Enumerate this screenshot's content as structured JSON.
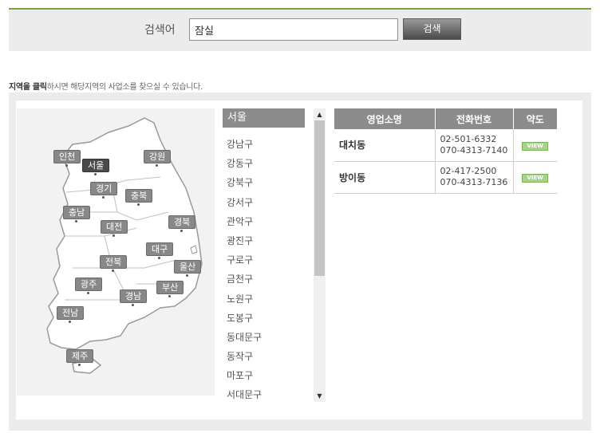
{
  "search": {
    "label": "검색어",
    "value": "잠실",
    "button": "검색"
  },
  "hint": {
    "bold": "지역을 클릭",
    "rest": "하시면 해당지역의 사업소를 찾으실 수 있습니다."
  },
  "map": {
    "regions": [
      {
        "label": "인천"
      },
      {
        "label": "서울",
        "active": true
      },
      {
        "label": "강원"
      },
      {
        "label": "경기"
      },
      {
        "label": "충북"
      },
      {
        "label": "충남"
      },
      {
        "label": "대전"
      },
      {
        "label": "경북"
      },
      {
        "label": "대구"
      },
      {
        "label": "전북"
      },
      {
        "label": "울산"
      },
      {
        "label": "광주"
      },
      {
        "label": "부산"
      },
      {
        "label": "경남"
      },
      {
        "label": "전남"
      },
      {
        "label": "제주"
      }
    ]
  },
  "districts": {
    "header": "서울",
    "items": [
      "강남구",
      "강동구",
      "강북구",
      "강서구",
      "관악구",
      "광진구",
      "구로구",
      "금천구",
      "노원구",
      "도봉구",
      "동대문구",
      "동작구",
      "마포구",
      "서대문구"
    ]
  },
  "table": {
    "headers": [
      "영업소명",
      "전화번호",
      "약도"
    ],
    "rows": [
      {
        "name": "대치동",
        "phone1": "02-501-6332",
        "phone2": "070-4313-7140",
        "map": "VIEW"
      },
      {
        "name": "방이동",
        "phone1": "02-417-2500",
        "phone2": "070-4313-7136",
        "map": "VIEW"
      }
    ]
  },
  "colors": {
    "accent": "#7aa33a",
    "region_tag": "#888888",
    "view_button": "#a8d488"
  }
}
